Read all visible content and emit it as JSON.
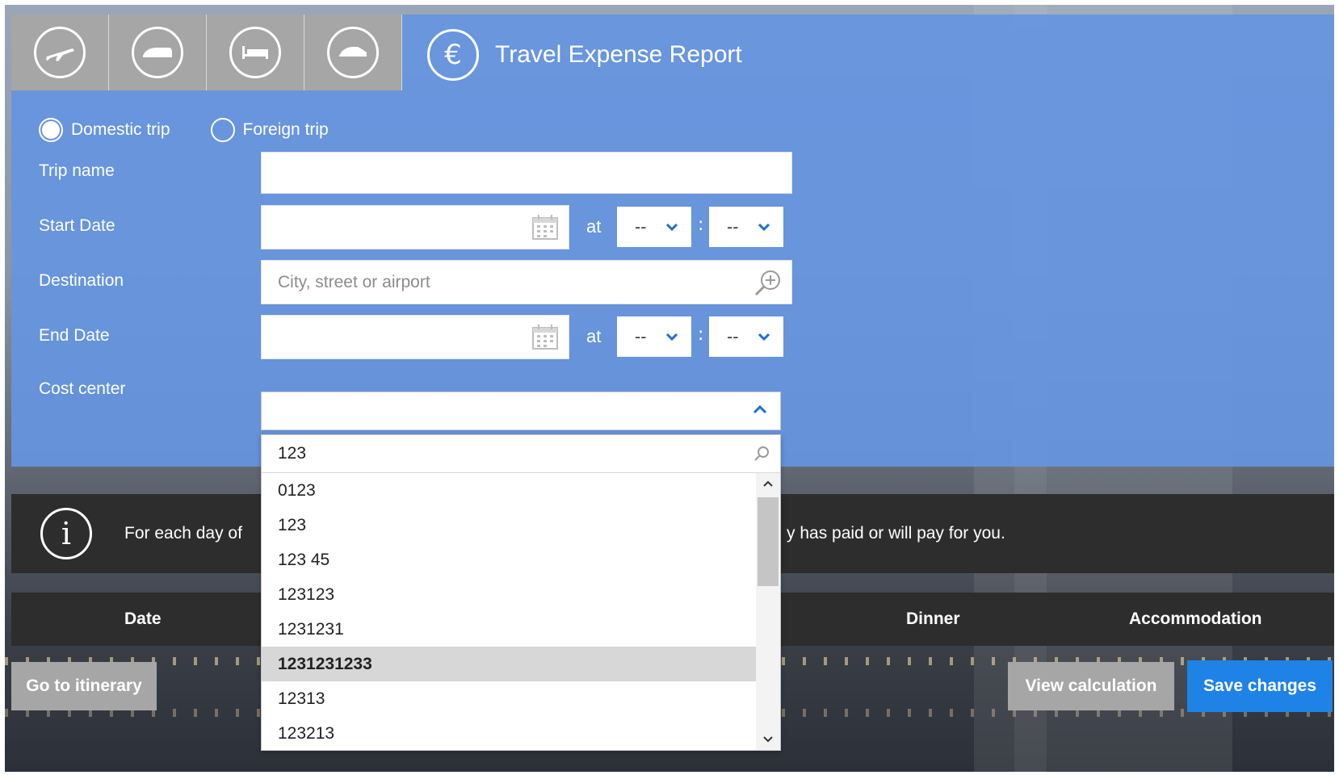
{
  "tabs": [
    {
      "icon": "airplane-icon"
    },
    {
      "icon": "train-icon"
    },
    {
      "icon": "bed-icon"
    },
    {
      "icon": "car-icon"
    }
  ],
  "header": {
    "title": "Travel Expense Report",
    "currency_symbol": "€"
  },
  "trip_type": {
    "options": [
      {
        "label": "Domestic trip",
        "selected": true
      },
      {
        "label": "Foreign trip",
        "selected": false
      }
    ]
  },
  "form": {
    "trip_name": {
      "label": "Trip name",
      "value": ""
    },
    "start_date": {
      "label": "Start Date",
      "value": "",
      "at": "at",
      "hour": "--",
      "minute": "--",
      "separator": ":"
    },
    "destination": {
      "label": "Destination",
      "placeholder": "City, street or airport"
    },
    "end_date": {
      "label": "End Date",
      "value": "",
      "at": "at",
      "hour": "--",
      "minute": "--",
      "separator": ":"
    },
    "cost_center": {
      "label": "Cost center",
      "value": ""
    }
  },
  "cost_center_dropdown": {
    "search_value": "123",
    "items": [
      "0123",
      "123",
      "123 45",
      "123123",
      "1231231",
      "1231231233",
      "12313",
      "123213"
    ],
    "highlighted": "1231231233"
  },
  "info": {
    "text_left": "For each day of",
    "text_right": "y has paid or will pay for you."
  },
  "table": {
    "headers": {
      "date": "Date",
      "dinner": "Dinner",
      "accommodation": "Accommodation"
    }
  },
  "actions": {
    "itinerary": "Go to itinerary",
    "view_calculation": "View calculation",
    "save": "Save changes"
  },
  "colors": {
    "panel": "#6594e0",
    "dark_bar": "#2d2d2d",
    "primary_button": "#1f82e6",
    "grey": "#a6a6a6"
  }
}
